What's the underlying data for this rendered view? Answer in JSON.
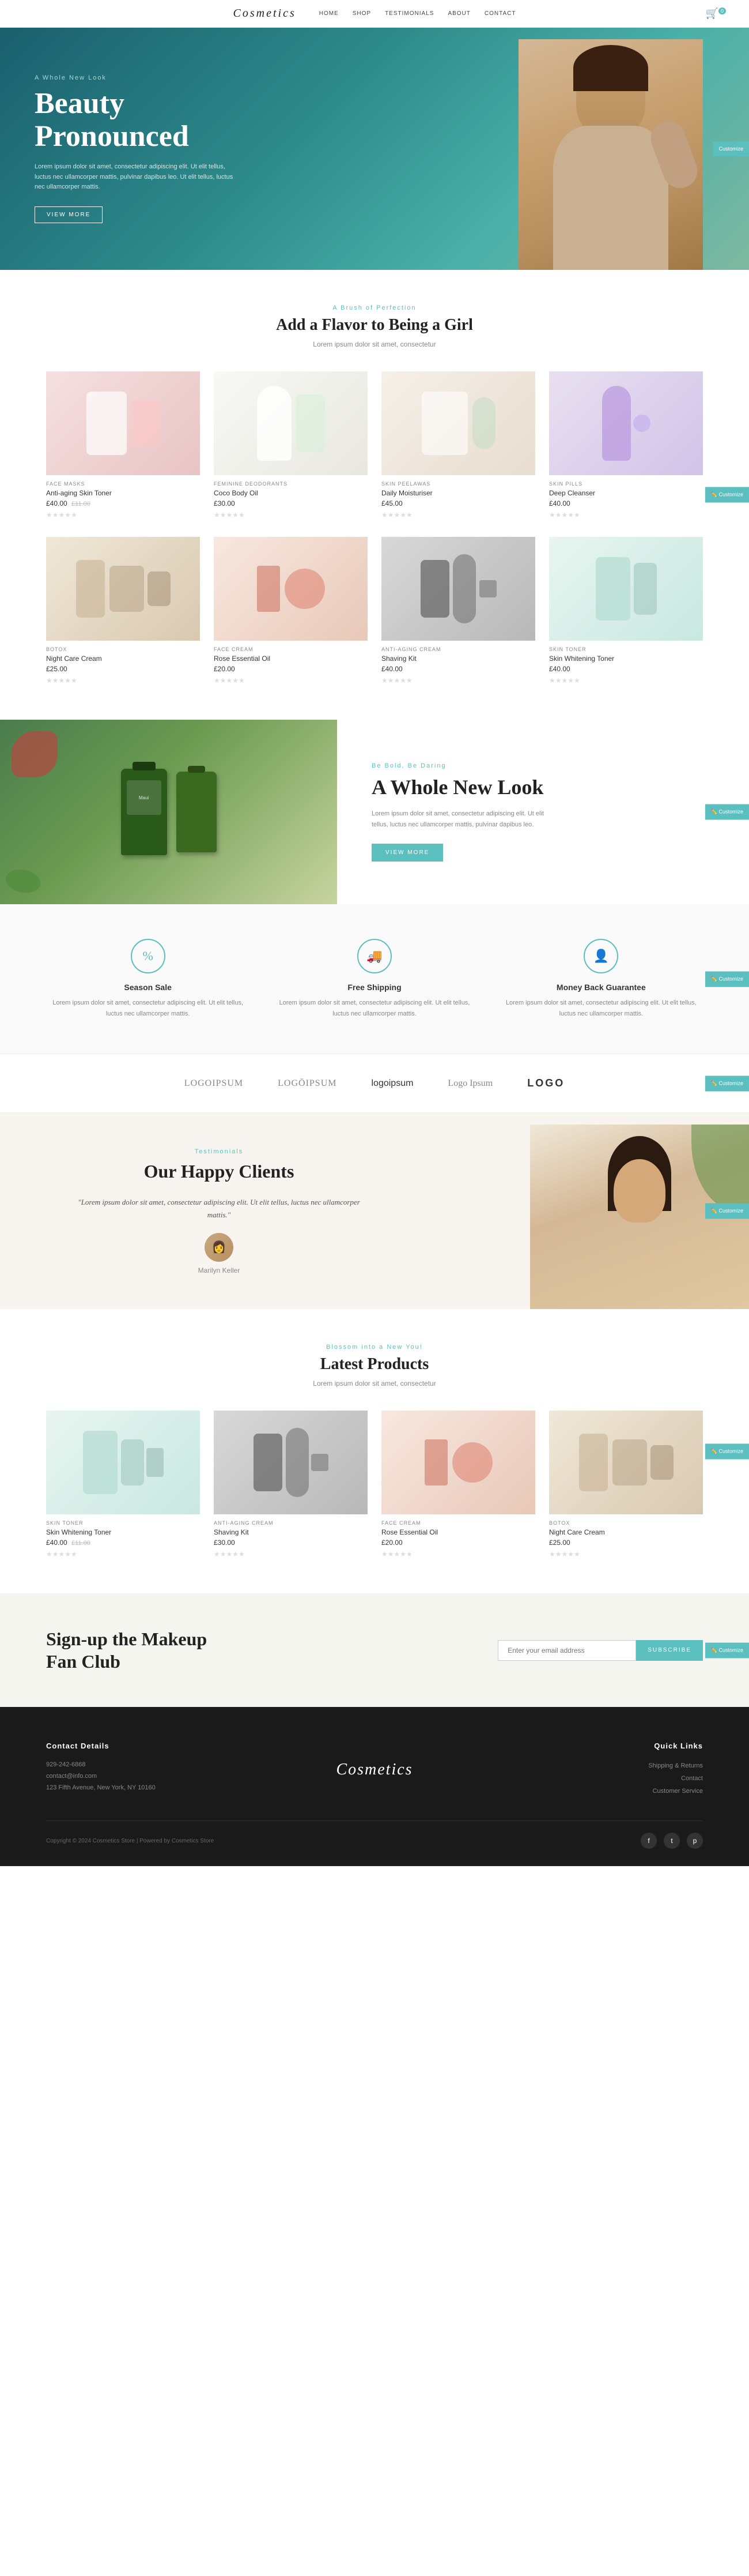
{
  "nav": {
    "logo": "Cosmetics",
    "links": [
      "HOME",
      "SHOP",
      "TESTIMONIALS",
      "ABOUT",
      "CONTACT"
    ],
    "cart_icon": "🛒",
    "cart_count": "0"
  },
  "hero": {
    "subtitle": "A Whole New Look",
    "title": "Beauty\nPronounced",
    "description": "Lorem ipsum dolor sit amet, consectetur adipiscing elit. Ut elit tellus, luctus nec ullamcorper mattis, pulvinar dapibus leo. Ut elit tellus, luctus nec ullamcorper mattis.",
    "cta": "VIEW MORE",
    "customize": "Customize"
  },
  "products_section": {
    "tag": "A Brush of Perfection",
    "title": "Add a Flavor to Being a Girl",
    "description": "Lorem ipsum dolor sit amet, consectetur",
    "products_row1": [
      {
        "category": "Face Masks",
        "name": "Anti-aging Skin Toner",
        "price": "£40.00",
        "old_price": "£11.00"
      },
      {
        "category": "Feminine Deodorants",
        "name": "Coco Body Oil",
        "price": "£30.00",
        "old_price": ""
      },
      {
        "category": "Skin Peelawas",
        "name": "Daily Moisturiser",
        "price": "£45.00",
        "old_price": ""
      },
      {
        "category": "Skin Pills",
        "name": "Deep Cleanser",
        "price": "£40.00",
        "old_price": ""
      }
    ],
    "products_row2": [
      {
        "category": "Botox",
        "name": "Night Care Cream",
        "price": "£25.00",
        "old_price": ""
      },
      {
        "category": "Face Cream",
        "name": "Rose Essential Oil",
        "price": "£20.00",
        "old_price": ""
      },
      {
        "category": "Anti-Aging Cream",
        "name": "Shaving Kit",
        "price": "£40.00",
        "old_price": ""
      },
      {
        "category": "Skin Toner",
        "name": "Skin Whitening Toner",
        "price": "£40.00",
        "old_price": ""
      }
    ],
    "customize": "Customize"
  },
  "promo": {
    "tag": "Be Bold, Be Daring",
    "title": "A Whole New Look",
    "description": "Lorem ipsum dolor sit amet, consectetur adipiscing elit. Ut elit tellus, luctus nec ullamcorper mattis, pulvinar dapibus leo.",
    "cta": "VIEW MORE",
    "customize": "Customize"
  },
  "features": {
    "customize": "Customize",
    "items": [
      {
        "icon": "%",
        "title": "Season Sale",
        "description": "Lorem ipsum dolor sit amet, consectetur adipiscing elit. Ut elit tellus, luctus nec ullamcorper mattis."
      },
      {
        "icon": "🚚",
        "title": "Free Shipping",
        "description": "Lorem ipsum dolor sit amet, consectetur adipiscing elit. Ut elit tellus, luctus nec ullamcorper mattis."
      },
      {
        "icon": "👤",
        "title": "Money Back Guarantee",
        "description": "Lorem ipsum dolor sit amet, consectetur adipiscing elit. Ut elit tellus, luctus nec ullamcorper mattis."
      }
    ]
  },
  "brands": {
    "customize": "Customize",
    "logos": [
      "LOGOIPSUM",
      "LOGŌIPSUM",
      "logoipsum",
      "Logo Ipsum",
      "LOGO"
    ]
  },
  "testimonials": {
    "tag": "Testimonials",
    "title": "Our Happy Clients",
    "quote": "\"Lorem ipsum dolor sit amet, consectetur adipiscing elit. Ut elit tellus, luctus nec ullamcorper mattis.\"",
    "reviewer": "Marilyn Keller",
    "customize": "Customize"
  },
  "latest_products": {
    "tag": "Blossom into a New You!",
    "title": "Latest Products",
    "description": "Lorem ipsum dolor sit amet, consectetur",
    "products": [
      {
        "category": "Skin Toner",
        "name": "Skin Whitening Toner",
        "price": "£40.00",
        "old_price": "£11.00"
      },
      {
        "category": "Anti-aging Cream",
        "name": "Shaving Kit",
        "price": "£30.00",
        "old_price": ""
      },
      {
        "category": "Face Cream",
        "name": "Rose Essential Oil",
        "price": "£20.00",
        "old_price": ""
      },
      {
        "category": "Botox",
        "name": "Night Care Cream",
        "price": "£25.00",
        "old_price": ""
      }
    ],
    "customize": "Customize"
  },
  "newsletter": {
    "title": "Sign-up the Makeup Fan Club",
    "placeholder": "Enter your email address",
    "button": "SUBSCRIBE",
    "customize": "Customize"
  },
  "footer": {
    "logo": "Cosmetics",
    "contact_title": "Contact Details",
    "contact_phone": "929-242-6868",
    "contact_email": "contact@info.com",
    "contact_address": "123 Fifth Avenue, New York, NY 10160",
    "links_title": "Quick Links",
    "links": [
      "Shipping & Returns",
      "Contact",
      "Customer Service"
    ],
    "copyright": "Copyright © 2024 Cosmetics Store | Powered by Cosmetics Store",
    "socials": [
      "f",
      "t",
      "p"
    ]
  }
}
